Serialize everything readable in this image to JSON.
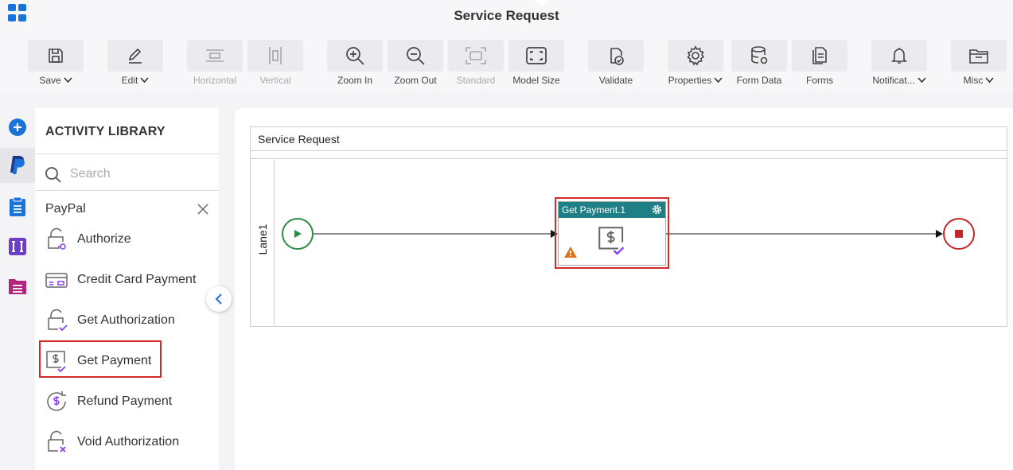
{
  "app": {
    "title": "Service Request"
  },
  "toolbar": {
    "save": "Save",
    "edit": "Edit",
    "horizontal": "Horizontal",
    "vertical": "Vertical",
    "zoom_in": "Zoom In",
    "zoom_out": "Zoom Out",
    "standard": "Standard",
    "model_size": "Model Size",
    "validate": "Validate",
    "properties": "Properties",
    "form_data": "Form Data",
    "forms": "Forms",
    "notifications": "Notificat...",
    "misc": "Misc"
  },
  "library": {
    "title": "ACTIVITY LIBRARY",
    "search_placeholder": "Search",
    "category": "PayPal",
    "items": [
      {
        "label": "Authorize",
        "icon": "lock-key-icon"
      },
      {
        "label": "Credit Card Payment",
        "icon": "credit-card-icon"
      },
      {
        "label": "Get Authorization",
        "icon": "lock-check-icon"
      },
      {
        "label": "Get Payment",
        "icon": "dollar-check-icon"
      },
      {
        "label": "Refund Payment",
        "icon": "refund-icon"
      },
      {
        "label": "Void Authorization",
        "icon": "lock-x-icon"
      }
    ],
    "highlighted_item": "Get Payment"
  },
  "canvas": {
    "pool_title": "Service Request",
    "lane_label": "Lane1",
    "task_name": "Get Payment.1",
    "task_has_warning": true
  },
  "colors": {
    "accent": "#1a73d9",
    "task_header": "#1e7f86",
    "start_event": "#2e8b47",
    "end_event": "#c4262e",
    "highlight": "#d42a2a",
    "activity_icon": "#8a3ff0"
  }
}
